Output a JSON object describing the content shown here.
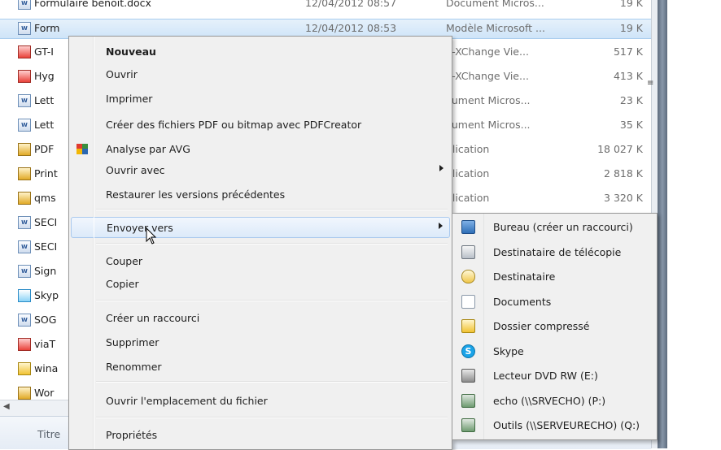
{
  "files": [
    {
      "name": "Formulaire benoit.docx",
      "date": "12/04/2012 08:57",
      "type": "Document Micros...",
      "size": "19 K",
      "icon": "word-doc-icon",
      "kind": "doc"
    },
    {
      "name": "Form",
      "date": "12/04/2012 08:53",
      "type": "Modèle Microsoft ...",
      "size": "19 K",
      "icon": "word-template-icon",
      "kind": "doc",
      "selected": true
    },
    {
      "name": "GT-I",
      "date": "",
      "type": "F-XChange Vie...",
      "size": "517 K",
      "icon": "pdf-icon",
      "kind": "pdf"
    },
    {
      "name": "Hyg",
      "date": "",
      "type": "F-XChange Vie...",
      "size": "413 K",
      "icon": "pdf-icon",
      "kind": "pdf"
    },
    {
      "name": "Lett",
      "date": "",
      "type": "cument Micros...",
      "size": "23 K",
      "icon": "word-doc-icon",
      "kind": "doc"
    },
    {
      "name": "Lett",
      "date": "",
      "type": "cument Micros...",
      "size": "35 K",
      "icon": "word-doc-icon",
      "kind": "doc"
    },
    {
      "name": "PDF",
      "date": "",
      "type": "plication",
      "size": "18 027 K",
      "icon": "app-icon",
      "kind": "app"
    },
    {
      "name": "Print",
      "date": "",
      "type": "plication",
      "size": "2 818 K",
      "icon": "app-icon",
      "kind": "app"
    },
    {
      "name": "qms",
      "date": "",
      "type": "plication",
      "size": "3 320 K",
      "icon": "app-icon",
      "kind": "app"
    },
    {
      "name": "SECI",
      "date": "",
      "type": "",
      "size": "",
      "icon": "word-doc-icon",
      "kind": "doc"
    },
    {
      "name": "SECI",
      "date": "",
      "type": "",
      "size": "",
      "icon": "word-doc-icon",
      "kind": "doc"
    },
    {
      "name": "Sign",
      "date": "",
      "type": "",
      "size": "",
      "icon": "word-doc-icon",
      "kind": "doc"
    },
    {
      "name": "Skyp",
      "date": "",
      "type": "",
      "size": "",
      "icon": "skype-file-icon",
      "kind": "sky"
    },
    {
      "name": "SOG",
      "date": "",
      "type": "",
      "size": "",
      "icon": "word-doc-icon",
      "kind": "doc"
    },
    {
      "name": "viaT",
      "date": "",
      "type": "",
      "size": "",
      "icon": "pdf-icon",
      "kind": "pdf"
    },
    {
      "name": "wina",
      "date": "",
      "type": "",
      "size": "",
      "icon": "zip-icon",
      "kind": "zip"
    },
    {
      "name": "Wor",
      "date": "",
      "type": "",
      "size": "",
      "icon": "app-icon",
      "kind": "app"
    }
  ],
  "detail": {
    "title": "Titre"
  },
  "menu": {
    "items": [
      {
        "label": "Nouveau",
        "bold": true
      },
      {
        "label": "Ouvrir"
      },
      {
        "label": "Imprimer"
      },
      {
        "label": "Créer des fichiers PDF ou bitmap avec PDFCreator"
      },
      {
        "label": "Analyse par AVG",
        "icon": "avg-icon"
      },
      {
        "label": "Ouvrir avec",
        "submenu": true
      },
      {
        "label": "Restaurer les versions précédentes"
      },
      {
        "label": "Envoyer vers",
        "submenu": true,
        "hover": true
      },
      {
        "label": "Couper"
      },
      {
        "label": "Copier"
      },
      {
        "label": "Créer un raccourci"
      },
      {
        "label": "Supprimer"
      },
      {
        "label": "Renommer"
      },
      {
        "label": "Ouvrir l'emplacement du fichier"
      },
      {
        "label": "Propriétés"
      }
    ]
  },
  "submenu": {
    "items": [
      {
        "label": "Bureau (créer un raccourci)",
        "icon": "desktop-icon",
        "kind": "desk"
      },
      {
        "label": "Destinataire de télécopie",
        "icon": "fax-icon",
        "kind": "fax"
      },
      {
        "label": "Destinataire",
        "icon": "mail-recipient-icon",
        "kind": "mail"
      },
      {
        "label": "Documents",
        "icon": "documents-icon",
        "kind": "doc"
      },
      {
        "label": "Dossier compressé",
        "icon": "zip-folder-icon",
        "kind": "zip"
      },
      {
        "label": "Skype",
        "icon": "skype-icon",
        "kind": "skype"
      },
      {
        "label": "Lecteur DVD RW (E:)",
        "icon": "dvd-drive-icon",
        "kind": "dvd"
      },
      {
        "label": "echo (\\\\SRVECHO) (P:)",
        "icon": "network-drive-icon",
        "kind": "net"
      },
      {
        "label": "Outils (\\\\SERVEURECHO) (Q:)",
        "icon": "network-drive-icon",
        "kind": "net"
      }
    ]
  },
  "colors": {
    "menu_bg": "#f0f0f0",
    "hover_border": "#aac9ee",
    "selection": "#cfe4f8"
  }
}
